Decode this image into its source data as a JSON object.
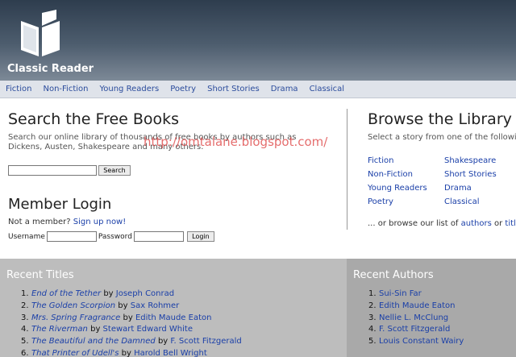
{
  "header": {
    "brand": "Classic Reader",
    "logo_icon": "open-book-icon"
  },
  "nav": [
    "Fiction",
    "Non-Fiction",
    "Young Readers",
    "Poetry",
    "Short Stories",
    "Drama",
    "Classical"
  ],
  "search": {
    "title": "Search the Free Books",
    "desc": "Search our online library of thousands of free books by authors such as Dickens, Austen, Shakespeare and many others.",
    "input_value": "",
    "button": "Search"
  },
  "watermark": "http://omtalane.blogspot.com/",
  "login": {
    "title": "Member Login",
    "prompt_prefix": "Not a member?",
    "signup_link": "Sign up now!",
    "username_label": "Username",
    "password_label": "Password",
    "button": "Login"
  },
  "browse": {
    "title": "Browse the Library",
    "desc": "Select a story from one of the following",
    "col1": [
      "Fiction",
      "Non-Fiction",
      "Young Readers",
      "Poetry"
    ],
    "col2": [
      "Shakespeare",
      "Short Stories",
      "Drama",
      "Classical"
    ],
    "foot_prefix": "... or browse our list of",
    "foot_link1": "authors",
    "foot_mid": "or",
    "foot_link2": "title"
  },
  "recent_titles": {
    "title": "Recent Titles",
    "by": "by",
    "items": [
      {
        "num": "1.",
        "title": "End of the Tether",
        "author": "Joseph Conrad"
      },
      {
        "num": "2.",
        "title": "The Golden Scorpion",
        "author": "Sax Rohmer"
      },
      {
        "num": "3.",
        "title": "Mrs. Spring Fragrance",
        "author": "Edith Maude Eaton"
      },
      {
        "num": "4.",
        "title": "The Riverman",
        "author": "Stewart Edward White"
      },
      {
        "num": "5.",
        "title": "The Beautiful and the Damned",
        "author": "F. Scott Fitzgerald"
      },
      {
        "num": "6.",
        "title": "That Printer of Udell's",
        "author": "Harold Bell Wright"
      }
    ]
  },
  "recent_authors": {
    "title": "Recent Authors",
    "items": [
      {
        "num": "1.",
        "name": "Sui-Sin Far"
      },
      {
        "num": "2.",
        "name": "Edith Maude Eaton"
      },
      {
        "num": "3.",
        "name": "Nellie L. McClung"
      },
      {
        "num": "4.",
        "name": "F. Scott Fitzgerald"
      },
      {
        "num": "5.",
        "name": "Louis Constant Wairy"
      }
    ]
  }
}
